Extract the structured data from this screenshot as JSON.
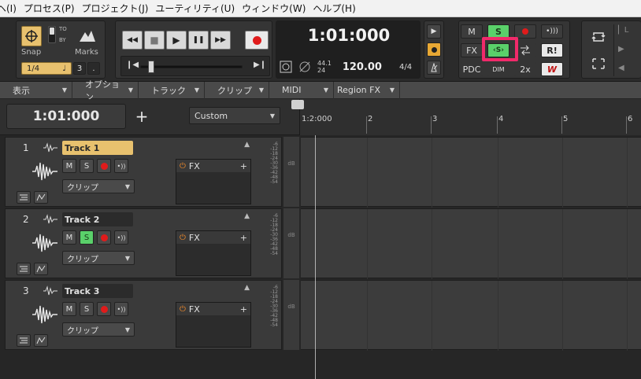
{
  "menubar": {
    "items": [
      "ヘ(I)",
      "プロセス(P)",
      "プロジェクト(J)",
      "ユーティリティ(U)",
      "ウィンドウ(W)",
      "ヘルプ(H)"
    ]
  },
  "snap": {
    "label": "Snap",
    "to_label": "TO",
    "by_label": "BY",
    "marks_label": "Marks",
    "value": "1/4",
    "note_glyph": "♩",
    "count": "3",
    "dot": "."
  },
  "transport": {
    "rewind": "◀◀",
    "stop": "■",
    "play": "▶",
    "pause": "❚❚",
    "forward": "▶▶",
    "go_start": "❙◀",
    "go_end": "▶❙"
  },
  "time_display": {
    "time": "1:01:000",
    "sample_rate": "44.1",
    "bit_depth": "24",
    "tempo": "120.00",
    "meter": "4/4"
  },
  "mix": {
    "m": "M",
    "s": "S",
    "fx": "FX",
    "r": "R!",
    "pdc": "PDC",
    "dim": "DIM",
    "x2": "2x",
    "w": "W"
  },
  "toolbar2": {
    "items": [
      "表示",
      "オプション",
      "トラック",
      "クリップ",
      "MIDI",
      "Region FX"
    ]
  },
  "strip": {
    "now_time": "1:01:000",
    "add": "+",
    "preset": "Custom"
  },
  "ruler": {
    "ticks": [
      "1:2:000",
      "2",
      "3",
      "4",
      "5",
      "6"
    ]
  },
  "tracks": [
    {
      "number": "1",
      "name": "Track 1",
      "m": "M",
      "s": "S",
      "clip": "クリップ",
      "fx": "FX",
      "solo": false,
      "selected": true
    },
    {
      "number": "2",
      "name": "Track 2",
      "m": "M",
      "s": "S",
      "clip": "クリップ",
      "fx": "FX",
      "solo": true,
      "selected": false
    },
    {
      "number": "3",
      "name": "Track 3",
      "m": "M",
      "s": "S",
      "clip": "クリップ",
      "fx": "FX",
      "solo": false,
      "selected": false
    }
  ],
  "meter_scale": [
    "-6",
    "-12",
    "-18",
    "-24",
    "-30",
    "-36",
    "-42",
    "-48",
    "-54"
  ],
  "db_label": "dB",
  "colors": {
    "accent_gold": "#e8c16e",
    "solo_green": "#5ad06a",
    "record_red": "#e01b1b",
    "highlight": "#f02a6a"
  }
}
